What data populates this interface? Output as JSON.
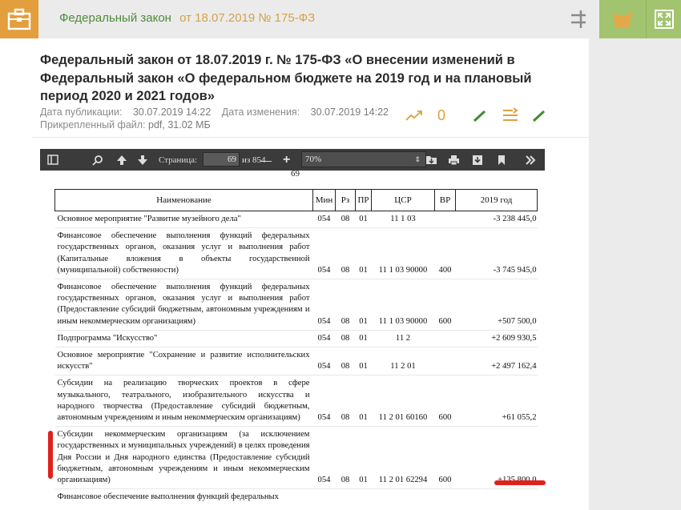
{
  "topbar": {
    "breadcrumb_law": "Федеральный закон",
    "breadcrumb_date": "от 18.07.2019 № 175-ФЗ",
    "icon_briefcase": "briefcase-icon",
    "icon_split": "split-view-icon",
    "icon_leaf": "leaf-icon",
    "icon_expand": "expand-icon",
    "colors": {
      "brief": "#e39e3d",
      "green": "#a2c46e",
      "law": "#4e8c3a",
      "date": "#d4a24a"
    }
  },
  "article": {
    "title": "Федеральный закон от 18.07.2019 г. № 175-ФЗ «О внесении изменений в Федеральный закон «О федеральном бюджете на 2019 год и на плановый период 2020 и 2021 годов»",
    "published_label": "Дата публикации:",
    "published_value": "30.07.2019 14:22",
    "changed_label": "Дата изменения:",
    "changed_value": "30.07.2019 14:22",
    "file_label": "Прикрепленный файл:",
    "file_value": "pdf, 31.02 МБ",
    "counter": "0"
  },
  "pdf_toolbar": {
    "page_label": "Страница:",
    "page_value": "69",
    "page_of": "из 854",
    "zoom_value": "70%",
    "page_number_under": "69"
  },
  "table": {
    "headers": [
      "Наименование",
      "Мин",
      "Рз",
      "ПР",
      "ЦСР",
      "ВР",
      "2019 год"
    ],
    "rows": [
      {
        "name": "Основное мероприятие \"Развитие музейного дела\"",
        "min": "054",
        "rz": "08",
        "pr": "01",
        "csr": "11 1 03",
        "vr": "",
        "amount": "-3 238 445,0"
      },
      {
        "name": "Финансовое обеспечение выполнения функций федеральных государственных органов, оказания услуг и выполнения работ (Капитальные вложения в объекты государственной (муниципальной) собственности)",
        "min": "054",
        "rz": "08",
        "pr": "01",
        "csr": "11 1 03 90000",
        "vr": "400",
        "amount": "-3 745 945,0"
      },
      {
        "name": "Финансовое обеспечение выполнения функций федеральных государственных органов, оказания услуг и выполнения работ (Предоставление субсидий бюджетным, автономным учреждениям и иным некоммерческим организациям)",
        "min": "054",
        "rz": "08",
        "pr": "01",
        "csr": "11 1 03 90000",
        "vr": "600",
        "amount": "+507 500,0"
      },
      {
        "name": "Подпрограмма \"Искусство\"",
        "min": "054",
        "rz": "08",
        "pr": "01",
        "csr": "11 2",
        "vr": "",
        "amount": "+2 609 930,5"
      },
      {
        "name": "Основное мероприятие \"Сохранение и развитие исполнительских искусств\"",
        "min": "054",
        "rz": "08",
        "pr": "01",
        "csr": "11 2 01",
        "vr": "",
        "amount": "+2 497 162,4"
      },
      {
        "name": "Субсидии на реализацию творческих проектов в сфере музыкального, театрального, изобразительного искусства и народного творчества (Предоставление субсидий бюджетным, автономным учреждениям и иным некоммерческим организациям)",
        "min": "054",
        "rz": "08",
        "pr": "01",
        "csr": "11 2 01 60160",
        "vr": "600",
        "amount": "+61 055,2"
      },
      {
        "name": "Субсидии некоммерческим организациям (за исключением государственных и муниципальных учреждений) в целях проведения Дня России и Дня народного единства (Предоставление субсидий бюджетным, автономным учреждениям и иным некоммерческим организациям)",
        "min": "054",
        "rz": "08",
        "pr": "01",
        "csr": "11 2 01 62294",
        "vr": "600",
        "amount": "+135 800,0"
      },
      {
        "name": "Финансовое обеспечение выполнения функций федеральных",
        "min": "",
        "rz": "",
        "pr": "",
        "csr": "",
        "vr": "",
        "amount": ""
      }
    ]
  }
}
